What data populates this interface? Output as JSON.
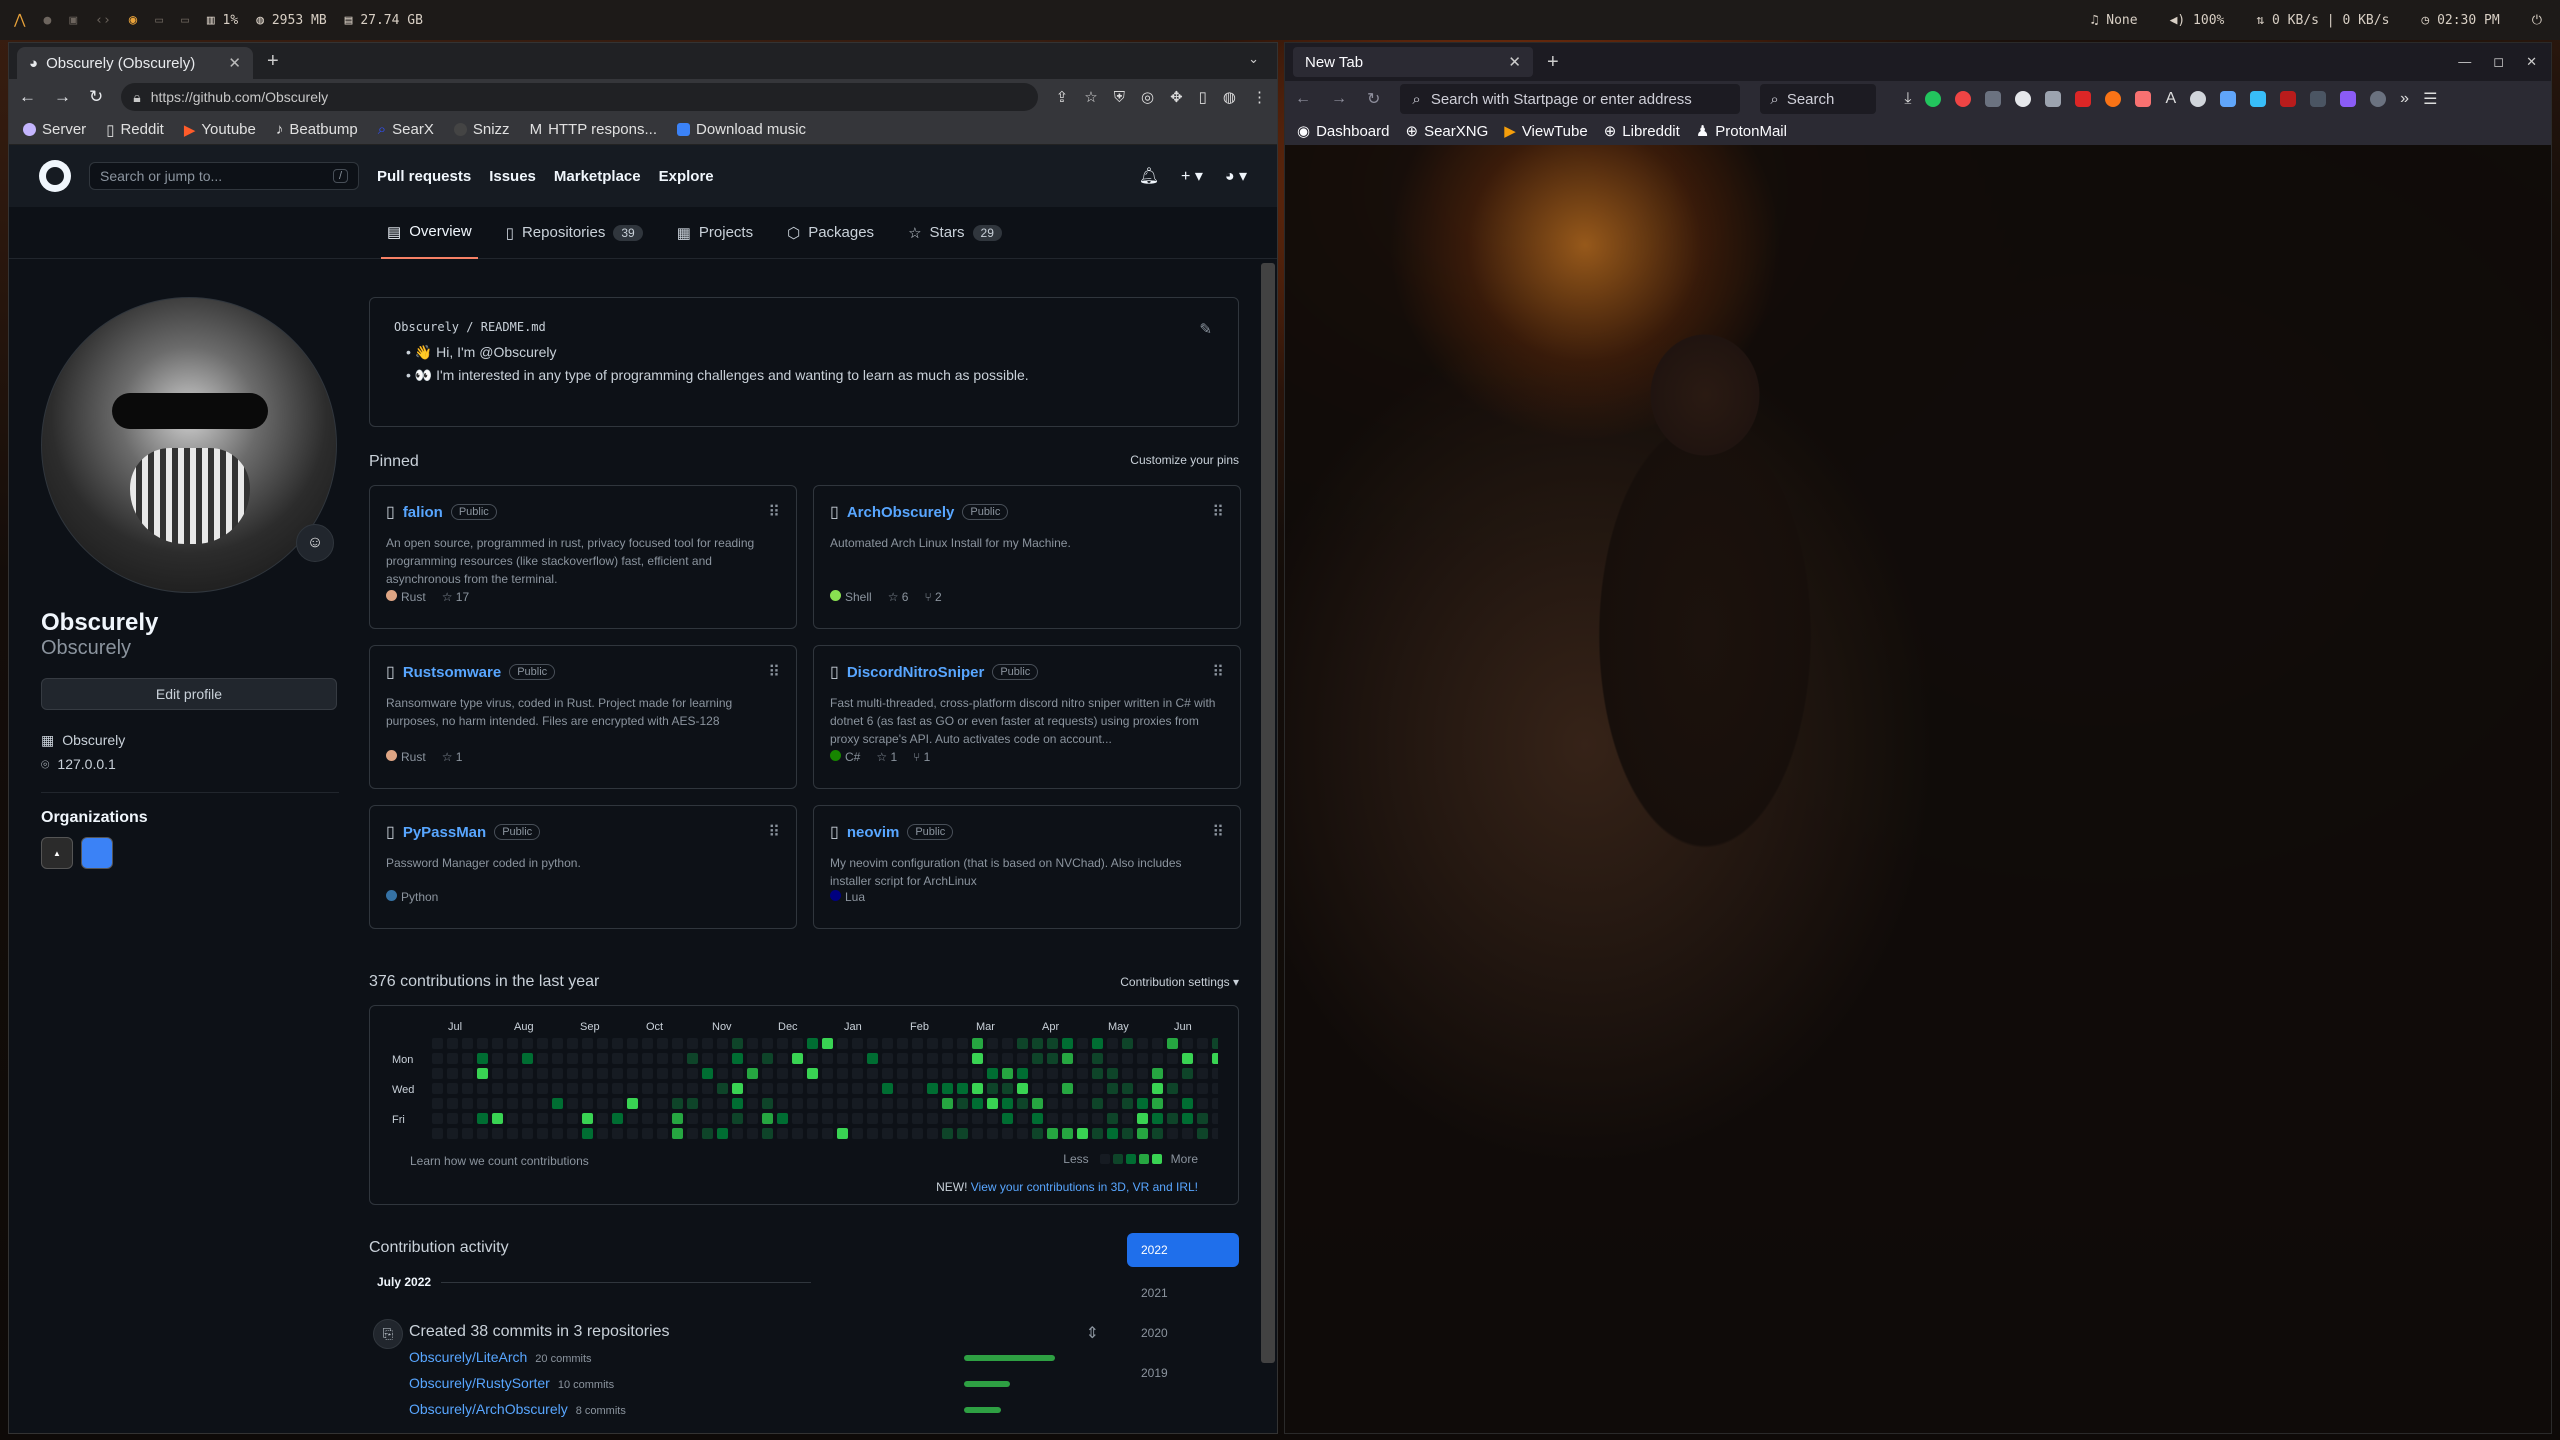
{
  "topbar": {
    "cpu": "1%",
    "mem": "2953 MB",
    "disk": "27.74 GB",
    "music": "None",
    "volume": "100%",
    "net": "0 KB/s | 0 KB/s",
    "clock": "02:30 PM"
  },
  "chrome": {
    "tab_title": "Obscurely (Obscurely)",
    "url": "https://github.com/Obscurely",
    "bookmarks": [
      {
        "label": "Server",
        "color": "#c4b5fd"
      },
      {
        "label": "Reddit",
        "color": "#ffffff"
      },
      {
        "label": "Youtube",
        "color": "#ff5c2a"
      },
      {
        "label": "Beatbump",
        "color": "#eeeeee"
      },
      {
        "label": "SearX",
        "color": "#3050ff"
      },
      {
        "label": "Snizz",
        "color": "#444444"
      },
      {
        "label": "HTTP respons...",
        "color": "#ffffff"
      },
      {
        "label": "Download music",
        "color": "#3b82f6"
      }
    ]
  },
  "github": {
    "search_placeholder": "Search or jump to...",
    "search_key": "/",
    "nav": [
      "Pull requests",
      "Issues",
      "Marketplace",
      "Explore"
    ],
    "tabs": [
      {
        "label": "Overview",
        "count": ""
      },
      {
        "label": "Repositories",
        "count": "39"
      },
      {
        "label": "Projects",
        "count": ""
      },
      {
        "label": "Packages",
        "count": ""
      },
      {
        "label": "Stars",
        "count": "29"
      }
    ],
    "profile": {
      "name": "Obscurely",
      "username": "Obscurely",
      "edit_label": "Edit profile",
      "company": "Obscurely",
      "location": "127.0.0.1",
      "orgs_title": "Organizations"
    },
    "readme": {
      "path_user": "Obscurely",
      "path_sep": "/",
      "path_file": "README.md",
      "line1": "👋 Hi, I'm @Obscurely",
      "line2": "👀 I'm interested in any type of programming challenges and wanting to learn as much as possible."
    },
    "pinned_title": "Pinned",
    "customize": "Customize your pins",
    "pins": [
      {
        "name": "falion",
        "badge": "Public",
        "desc": "An open source, programmed in rust, privacy focused tool for reading programming resources (like stackoverflow) fast, efficient and asynchronous from the terminal.",
        "lang": "Rust",
        "lang_color": "#dea584",
        "stars": "17",
        "forks": ""
      },
      {
        "name": "ArchObscurely",
        "badge": "Public",
        "desc": "Automated Arch Linux Install for my Machine.",
        "lang": "Shell",
        "lang_color": "#89e051",
        "stars": "6",
        "forks": "2"
      },
      {
        "name": "Rustsomware",
        "badge": "Public",
        "desc": "Ransomware type virus, coded in Rust. Project made for learning purposes, no harm intended. Files are encrypted with AES-128",
        "lang": "Rust",
        "lang_color": "#dea584",
        "stars": "1",
        "forks": ""
      },
      {
        "name": "DiscordNitroSniper",
        "badge": "Public",
        "desc": "Fast multi-threaded, cross-platform discord nitro sniper written in C# with dotnet 6 (as fast as GO or even faster at requests) using proxies from proxy scrape's API. Auto activates code on account...",
        "lang": "C#",
        "lang_color": "#178600",
        "stars": "1",
        "forks": "1"
      },
      {
        "name": "PyPassMan",
        "badge": "Public",
        "desc": "Password Manager coded in python.",
        "lang": "Python",
        "lang_color": "#3572A5",
        "stars": "",
        "forks": ""
      },
      {
        "name": "neovim",
        "badge": "Public",
        "desc": "My neovim configuration (that is based on NVChad). Also includes installer script for ArchLinux",
        "lang": "Lua",
        "lang_color": "#000080",
        "stars": "",
        "forks": ""
      }
    ],
    "contributions": {
      "title": "376 contributions in the last year",
      "settings": "Contribution settings ▾",
      "months": [
        "Jul",
        "Aug",
        "Sep",
        "Oct",
        "Nov",
        "Dec",
        "Jan",
        "Feb",
        "Mar",
        "Apr",
        "May",
        "Jun"
      ],
      "days": [
        "Mon",
        "Wed",
        "Fri"
      ],
      "learn": "Learn how we count contributions",
      "less": "Less",
      "more": "More",
      "new_label": "NEW!",
      "new_link": "View your contributions in 3D, VR and IRL!"
    },
    "activity": {
      "title": "Contribution activity",
      "years": [
        "2022",
        "2021",
        "2020",
        "2019"
      ],
      "month": "July 2022",
      "event": "Created 38 commits in 3 repositories",
      "repos": [
        {
          "name": "Obscurely/LiteArch",
          "commits": "20 commits",
          "pct": 0.52
        },
        {
          "name": "Obscurely/RustySorter",
          "commits": "10 commits",
          "pct": 0.26
        },
        {
          "name": "Obscurely/ArchObscurely",
          "commits": "8 commits",
          "pct": 0.21
        }
      ]
    }
  },
  "firefox": {
    "tab_title": "New Tab",
    "url_placeholder": "Search with Startpage or enter address",
    "search_placeholder": "Search",
    "bookmarks": [
      "Dashboard",
      "SearXNG",
      "ViewTube",
      "Libreddit",
      "ProtonMail"
    ]
  }
}
